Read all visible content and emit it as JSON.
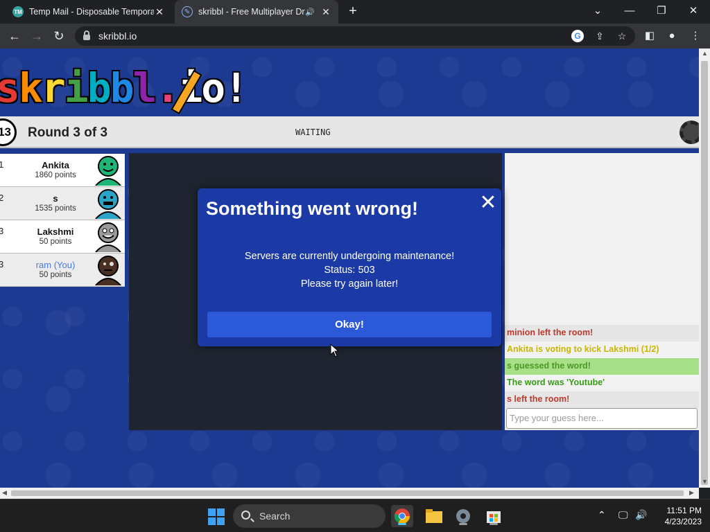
{
  "browser": {
    "tabs": [
      {
        "title": "Temp Mail - Disposable Tempora",
        "favicon": "TM"
      },
      {
        "title": "skribbl - Free Multiplayer Dra",
        "favicon": "pencil-circle"
      }
    ],
    "url": "skribbl.io"
  },
  "game": {
    "logo_letters": [
      "s",
      "k",
      "r",
      "i",
      "b",
      "b",
      "l",
      ".",
      "i",
      "o",
      "!"
    ],
    "clock_value": "13",
    "round_label": "Round 3 of 3",
    "status_word": "WAITING",
    "players": [
      {
        "rank": "1",
        "name": "Ankita",
        "points": "1860 points",
        "avatar_color": "#1fb576"
      },
      {
        "rank": "2",
        "name": "s",
        "points": "1535 points",
        "avatar_color": "#2aa5c8"
      },
      {
        "rank": "3",
        "name": "Lakshmi",
        "points": "50 points",
        "avatar_color": "#9a9a9a"
      },
      {
        "rank": "3",
        "name": "ram (You)",
        "points": "50 points",
        "avatar_color": "#4a2f22"
      }
    ],
    "chat": [
      {
        "text": "minion left the room!",
        "color": "#c0392b",
        "bg": "#e6e6e6"
      },
      {
        "text": "Ankita is voting to kick Lakshmi (1/2)",
        "color": "#c9b600",
        "bg": "#f2f2f2"
      },
      {
        "text": "s guessed the word!",
        "color": "#4a9a1e",
        "bg": "#a8e089"
      },
      {
        "text": "The word was 'Youtube'",
        "color": "#3a9a1a",
        "bg": "#f2f2f2"
      },
      {
        "text": "s left the room!",
        "color": "#c0392b",
        "bg": "#e6e6e6"
      }
    ],
    "guess_placeholder": "Type your guess here..."
  },
  "modal": {
    "title": "Something went wrong!",
    "line1": "Servers are currently undergoing maintenance!",
    "line2": "Status: 503",
    "line3": "Please try again later!",
    "button": "Okay!"
  },
  "taskbar": {
    "search_label": "Search",
    "time": "11:51 PM",
    "date": "4/23/2023"
  }
}
